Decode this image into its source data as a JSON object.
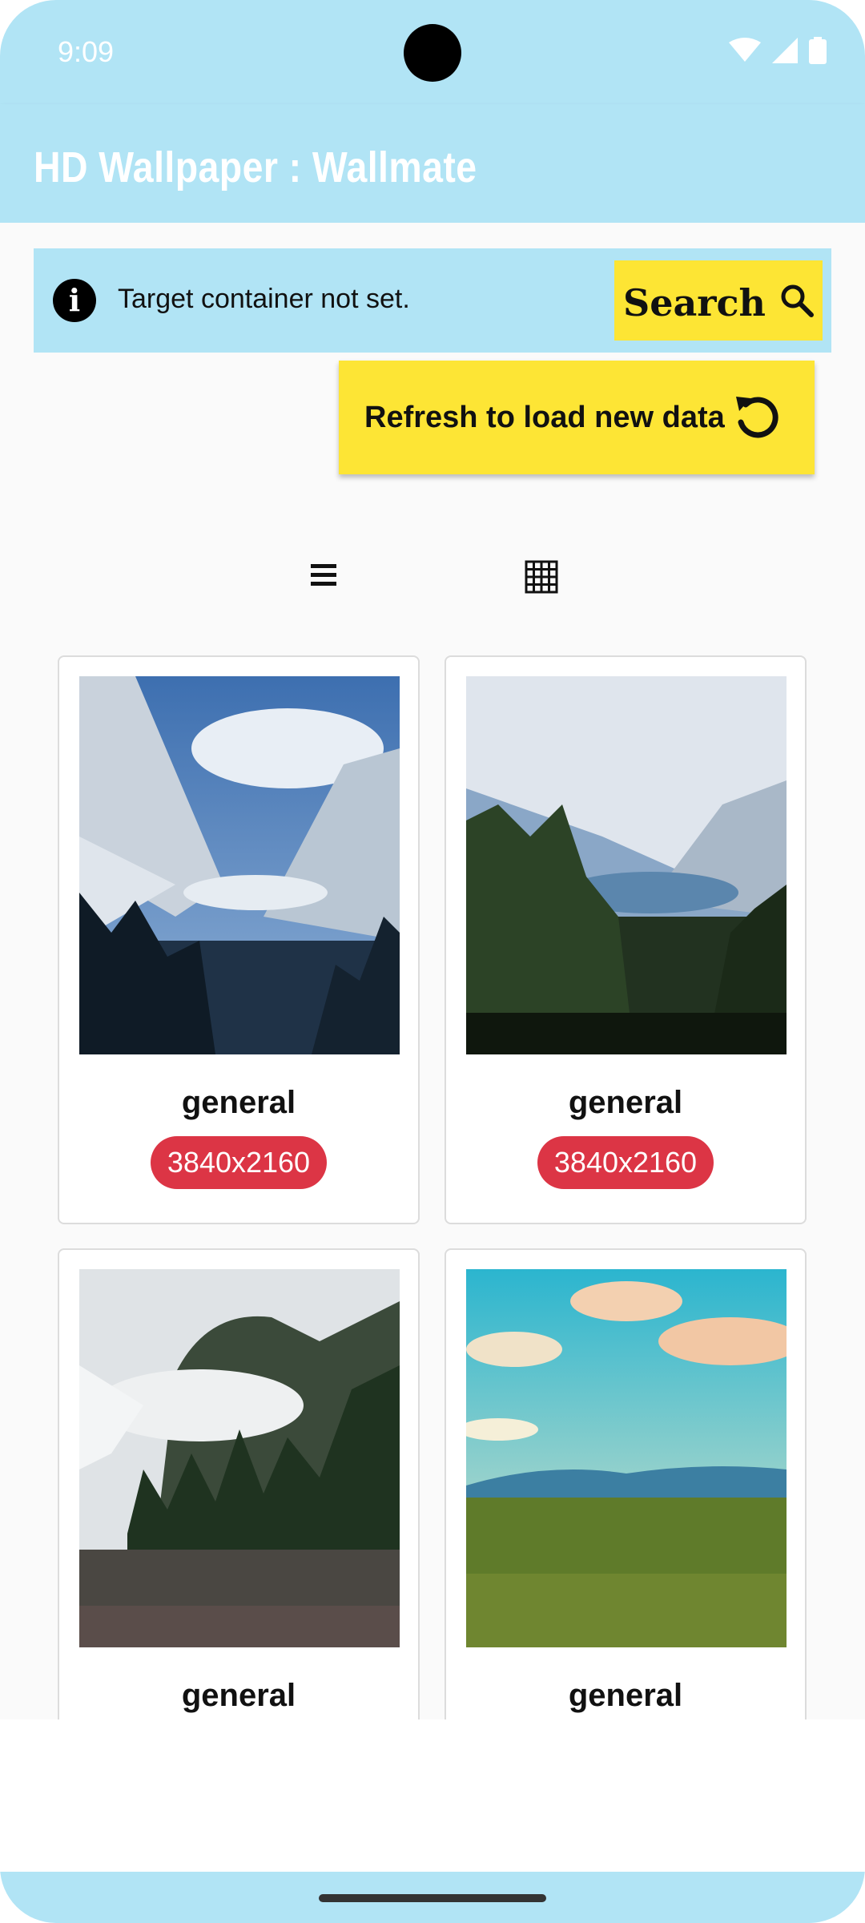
{
  "status_bar": {
    "time": "9:09",
    "icons": [
      "wifi-icon",
      "signal-icon",
      "battery-icon"
    ]
  },
  "app_bar": {
    "title": "HD Wallpaper : Wallmate"
  },
  "info_bar": {
    "icon": "info-icon",
    "message": "Target container not set."
  },
  "search_button": {
    "label": "Search",
    "icon": "search-icon"
  },
  "refresh_button": {
    "label": "Refresh to load new data",
    "icon": "refresh-icon"
  },
  "view_toggles": [
    "list-view-icon",
    "grid-view-icon"
  ],
  "wallpapers": [
    {
      "category": "general",
      "resolution": "3840x2160"
    },
    {
      "category": "general",
      "resolution": "3840x2160"
    },
    {
      "category": "general"
    },
    {
      "category": "general"
    }
  ],
  "colors": {
    "app_bar": "#b1e4f5",
    "accent_yellow": "#fde534",
    "badge_red": "#dc3545"
  }
}
